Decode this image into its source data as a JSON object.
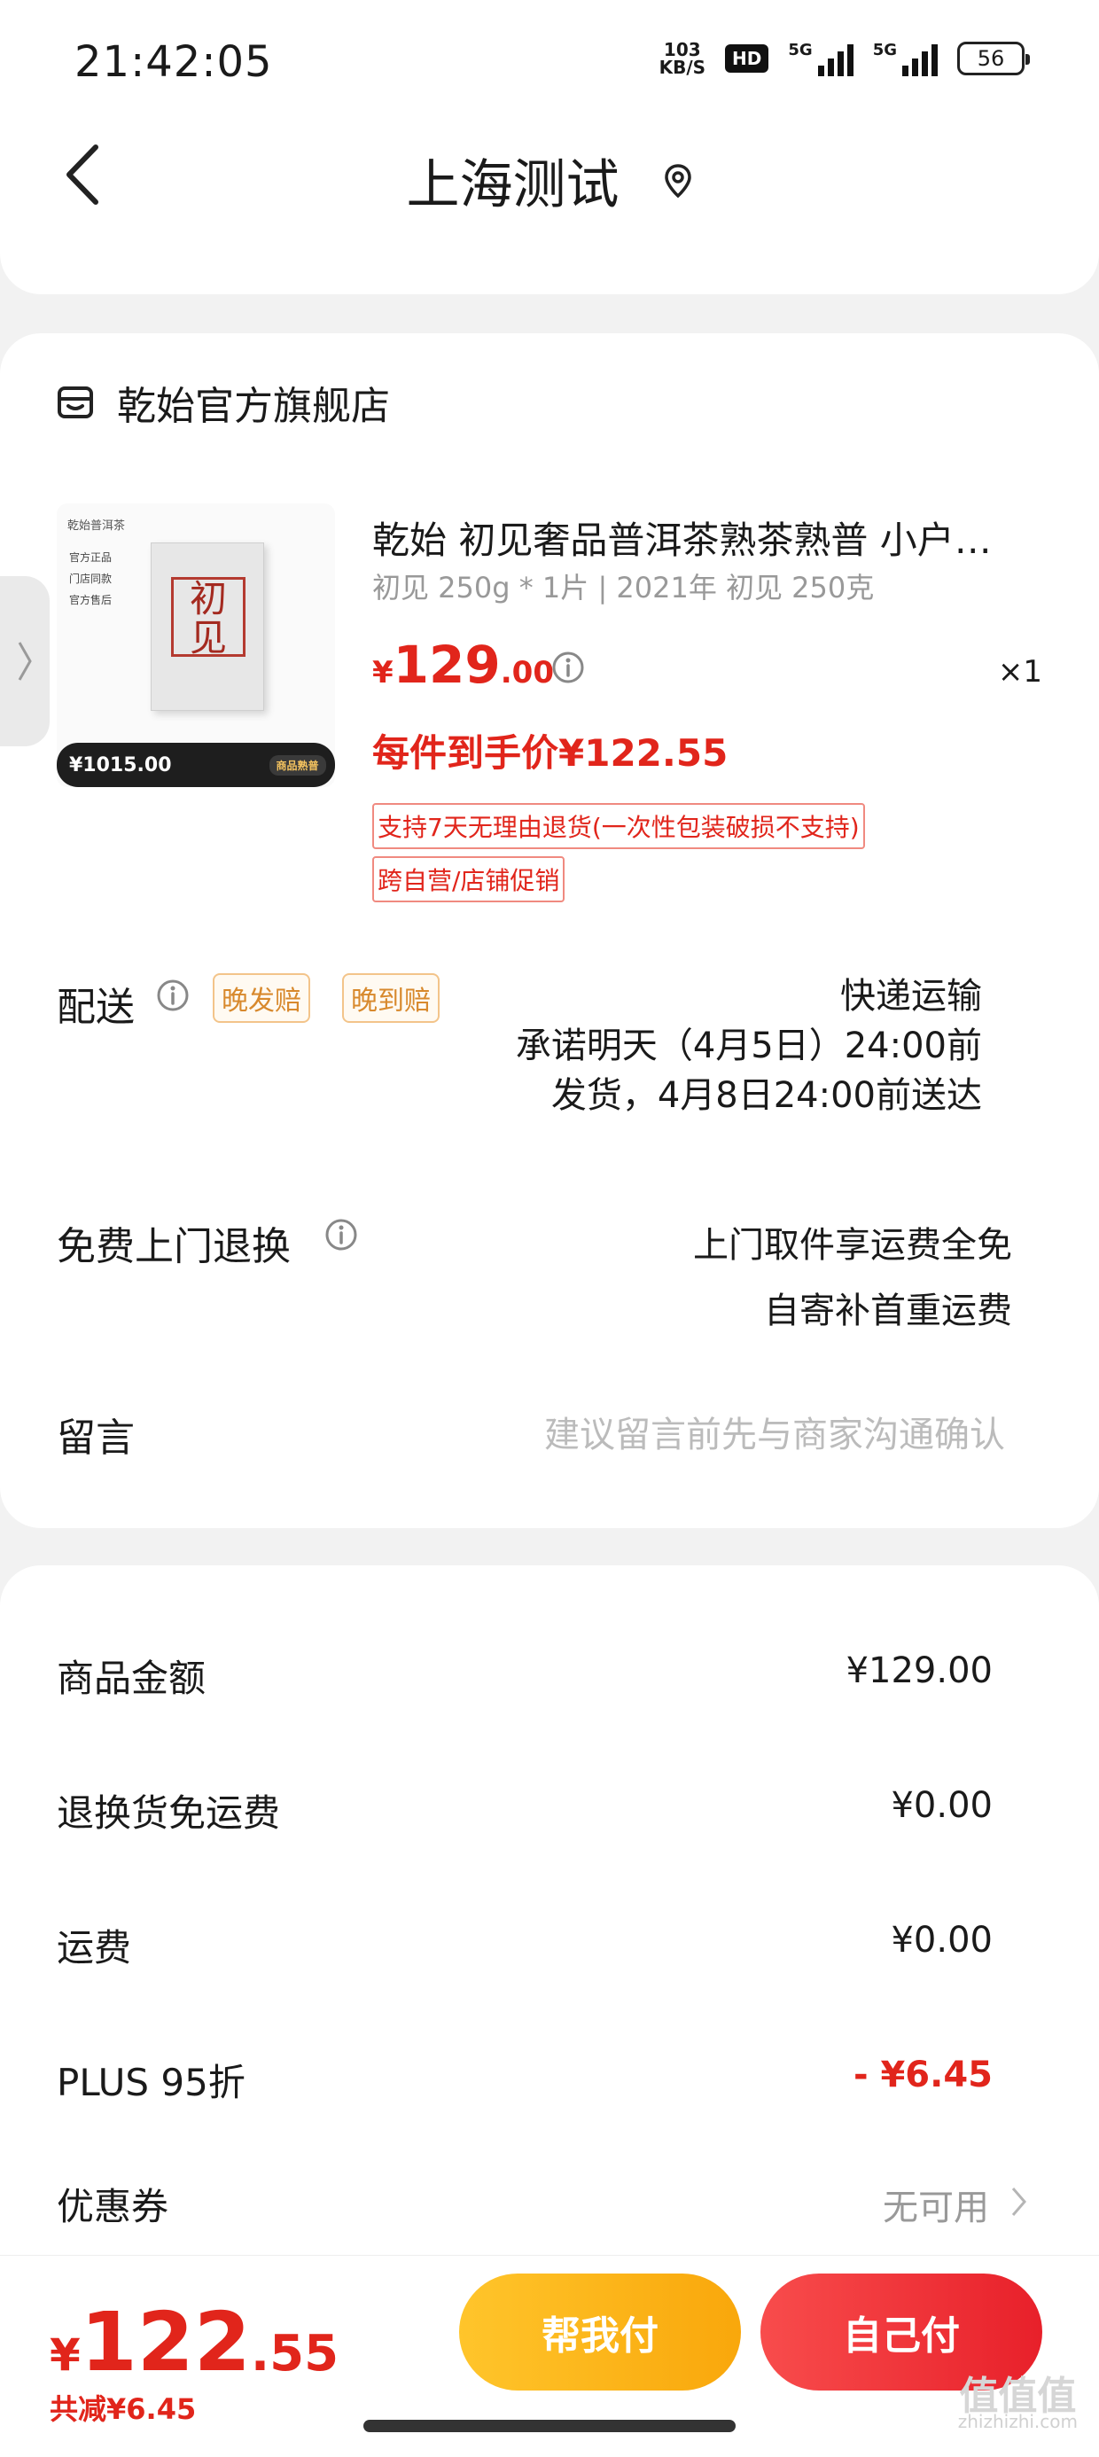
{
  "status_bar": {
    "time": "21:42:05",
    "net_speed_value": "103",
    "net_speed_unit": "KB/S",
    "hd_label": "HD",
    "sim1_label": "5G",
    "sim2_label": "5G",
    "battery": "56"
  },
  "header": {
    "title": "上海测试"
  },
  "store": {
    "name": "乾始官方旗舰店"
  },
  "product": {
    "image": {
      "brand_text": "乾始普洱茶",
      "features": [
        "官方正品",
        "门店同款",
        "官方售后"
      ],
      "seal_text": "初见",
      "price_tag": "¥1015.00",
      "badge": "商品熟普"
    },
    "title": "乾始 初见奢品普洱茶熟茶熟普 小户…",
    "spec": "初见 250g * 1片 | 2021年 初见 250克",
    "price_symbol": "¥",
    "price_int": "129",
    "price_dec": ".00",
    "quantity": "×1",
    "unit_price": "每件到手价¥122.55",
    "tags": [
      "支持7天无理由退货(一次性包装破损不支持)",
      "跨自营/店铺促销"
    ]
  },
  "delivery": {
    "label": "配送",
    "pills": [
      "晚发赔",
      "晚到赔"
    ],
    "method": "快递运输",
    "promise_line1": "承诺明天（4月5日）24:00前",
    "promise_line2": "发货，4月8日24:00前送达"
  },
  "return_service": {
    "label": "免费上门退换",
    "line1": "上门取件享运费全免",
    "line2": "自寄补首重运费"
  },
  "message": {
    "label": "留言",
    "placeholder": "建议留言前先与商家沟通确认"
  },
  "summary": {
    "rows": [
      {
        "label": "商品金额",
        "value": "¥129.00"
      },
      {
        "label": "退换货免运费",
        "value": "¥0.00"
      },
      {
        "label": "运费",
        "value": "¥0.00"
      },
      {
        "label": "PLUS 95折",
        "value": "- ¥6.45"
      },
      {
        "label": "优惠券",
        "value": "无可用"
      }
    ]
  },
  "bottom_bar": {
    "total_symbol": "¥",
    "total_int": "122",
    "total_dec": ".55",
    "saved": "共减¥6.45",
    "help_pay": "帮我付",
    "self_pay": "自己付"
  },
  "watermark": {
    "logo_text": "值值值",
    "site": "zhizhizhi.com"
  },
  "colors": {
    "accent_red": "#e1251b",
    "help_button": "#f9a70b",
    "pill_orange": "#d8892d"
  }
}
